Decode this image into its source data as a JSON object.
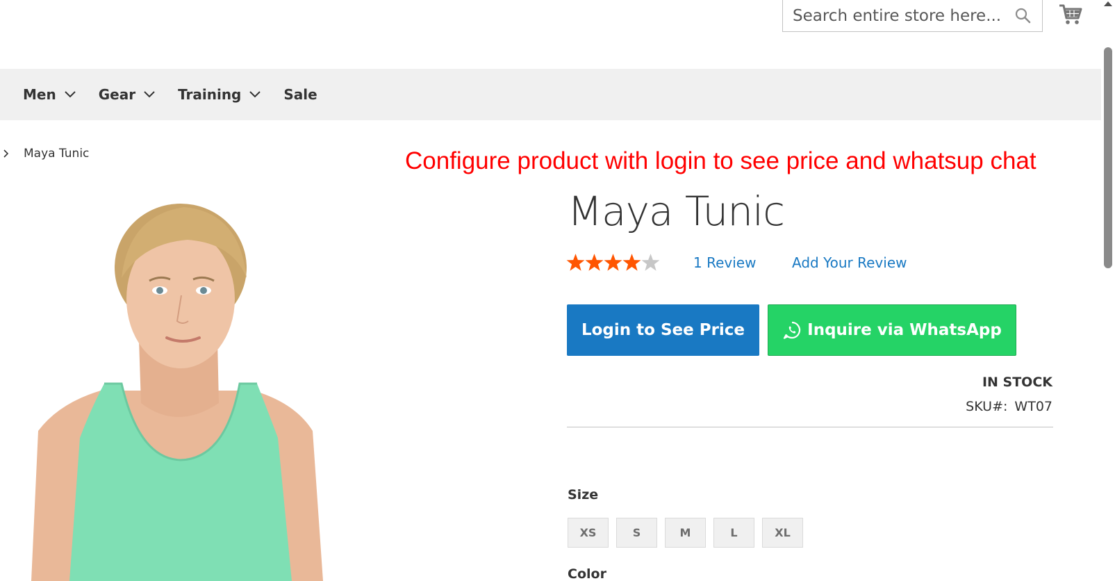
{
  "header": {
    "search_placeholder": "Search entire store here...",
    "search_icon": "search-icon",
    "cart_icon": "cart-icon"
  },
  "nav": {
    "items": [
      {
        "label": "Men",
        "has_dropdown": true
      },
      {
        "label": "Gear",
        "has_dropdown": true
      },
      {
        "label": "Training",
        "has_dropdown": true
      },
      {
        "label": "Sale",
        "has_dropdown": false
      }
    ]
  },
  "breadcrumb": {
    "current": "Maya Tunic"
  },
  "promo": {
    "text": "Configure product with login to see price and whatsup chat",
    "color": "#ff0000"
  },
  "product": {
    "title": "Maya Tunic",
    "rating": {
      "stars_filled": 4,
      "stars_total": 5,
      "star_color": "#ff5501",
      "empty_color": "#c7c7c7"
    },
    "review_count_text": "1  Review",
    "add_review_text": "Add Your Review",
    "login_button": "Login to See Price",
    "whatsapp_button": "Inquire via WhatsApp",
    "stock_status": "IN STOCK",
    "sku_label": "SKU#:",
    "sku_value": "WT07",
    "size_label": "Size",
    "sizes": [
      "XS",
      "S",
      "M",
      "L",
      "XL"
    ],
    "color_label": "Color"
  },
  "colors": {
    "accent_blue": "#1979c3",
    "whatsapp_green": "#25d366",
    "nav_bg": "#f0f0f0"
  }
}
